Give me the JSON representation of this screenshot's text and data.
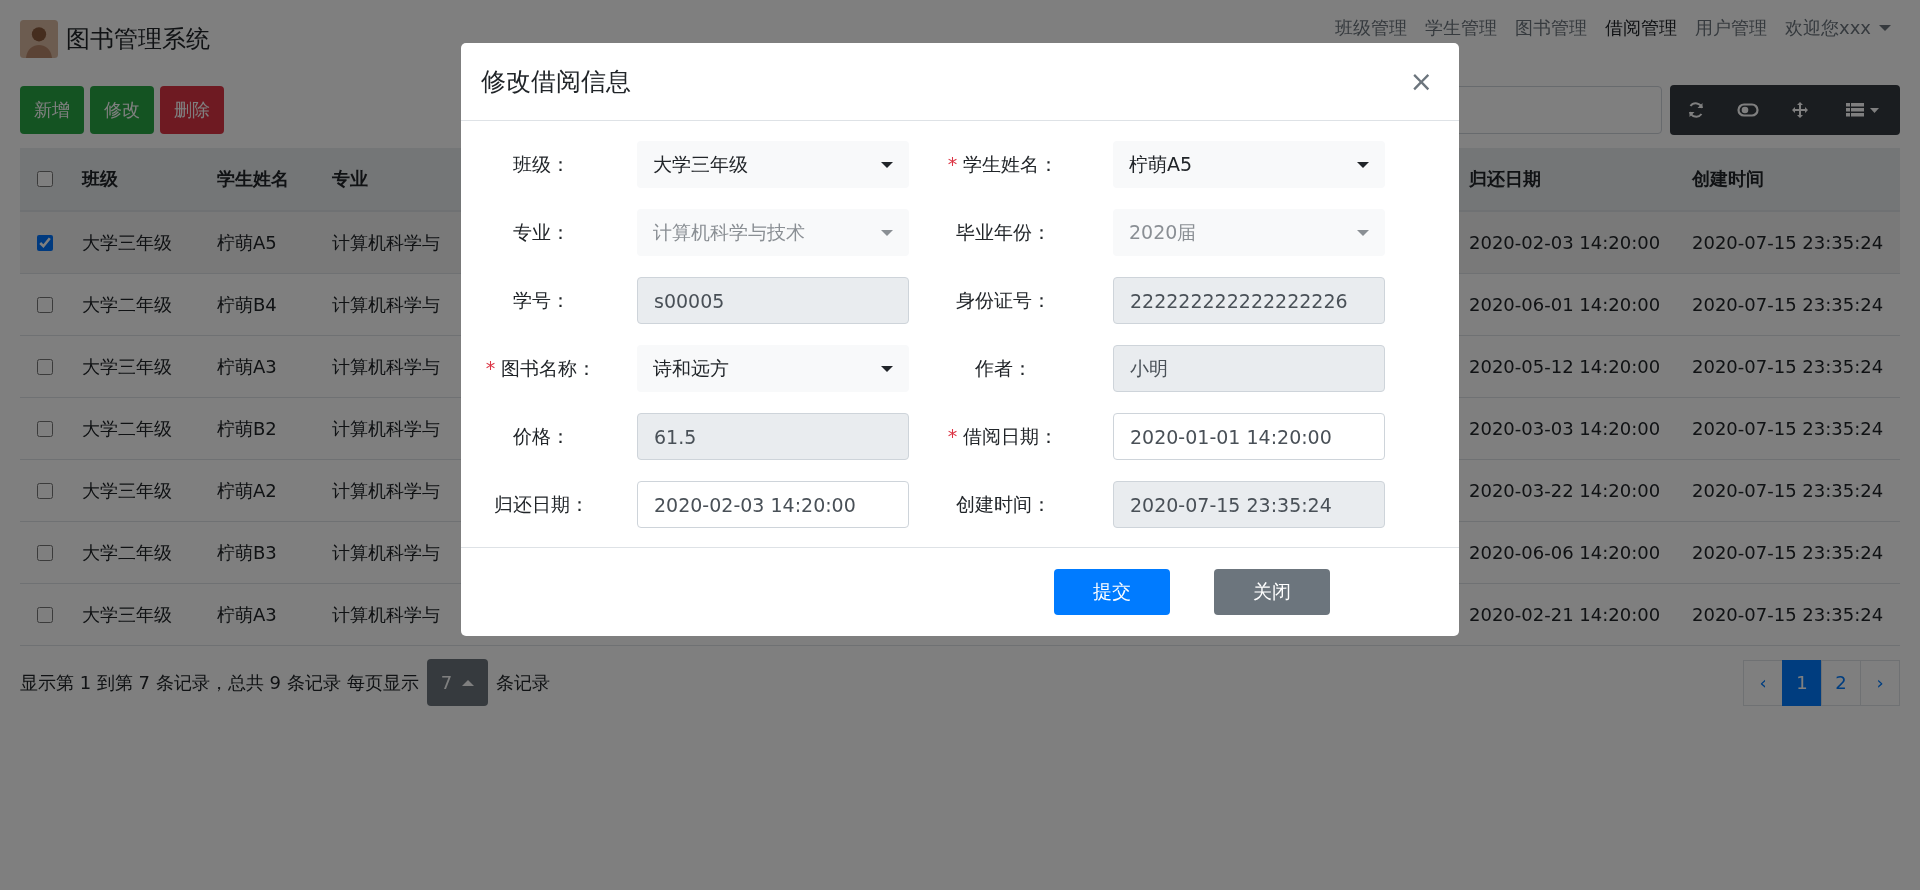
{
  "navbar": {
    "brand": "图书管理系统",
    "items": [
      {
        "label": "班级管理",
        "selected": false
      },
      {
        "label": "学生管理",
        "selected": false
      },
      {
        "label": "图书管理",
        "selected": false
      },
      {
        "label": "借阅管理",
        "selected": true
      },
      {
        "label": "用户管理",
        "selected": false
      }
    ],
    "user_menu": "欢迎您xxx"
  },
  "actions": [
    {
      "label": "新增",
      "kind": "success"
    },
    {
      "label": "修改",
      "kind": "success"
    },
    {
      "label": "删除",
      "kind": "danger"
    }
  ],
  "table": {
    "select_all_checked": false,
    "columns": [
      {
        "label": "班级",
        "kind": "narrow"
      },
      {
        "label": "学生姓名",
        "kind": "narrow"
      },
      {
        "label": "专业",
        "kind": "wide"
      },
      {
        "label": "归还日期",
        "kind": "date"
      },
      {
        "label": "创建时间",
        "kind": "date"
      }
    ],
    "rows": [
      {
        "selected": true,
        "cells": [
          "大学三年级",
          "柠萌A5",
          "计算机科学与",
          "2020-02-03 14:20:00",
          "2020-07-15 23:35:24"
        ]
      },
      {
        "selected": false,
        "cells": [
          "大学二年级",
          "柠萌B4",
          "计算机科学与",
          "2020-06-01 14:20:00",
          "2020-07-15 23:35:24"
        ]
      },
      {
        "selected": false,
        "cells": [
          "大学三年级",
          "柠萌A3",
          "计算机科学与",
          "2020-05-12 14:20:00",
          "2020-07-15 23:35:24"
        ]
      },
      {
        "selected": false,
        "cells": [
          "大学二年级",
          "柠萌B2",
          "计算机科学与",
          "2020-03-03 14:20:00",
          "2020-07-15 23:35:24"
        ]
      },
      {
        "selected": false,
        "cells": [
          "大学三年级",
          "柠萌A2",
          "计算机科学与",
          "2020-03-22 14:20:00",
          "2020-07-15 23:35:24"
        ]
      },
      {
        "selected": false,
        "cells": [
          "大学二年级",
          "柠萌B3",
          "计算机科学与",
          "2020-06-06 14:20:00",
          "2020-07-15 23:35:24"
        ]
      },
      {
        "selected": false,
        "cells": [
          "大学三年级",
          "柠萌A3",
          "计算机科学与",
          "2020-02-21 14:20:00",
          "2020-07-15 23:35:24"
        ]
      }
    ]
  },
  "pagination": {
    "summary": "显示第 1 到第 7 条记录，总共 9 条记录",
    "per_page_label": "每页显示",
    "per_page": "7",
    "per_page_suffix": "条记录",
    "pages": [
      {
        "label": "‹",
        "selected": false
      },
      {
        "label": "1",
        "selected": true
      },
      {
        "label": "2",
        "selected": false
      },
      {
        "label": "›",
        "selected": false
      }
    ]
  },
  "dialog": {
    "title": "修改借阅信息",
    "close": "×",
    "required_mark": "*",
    "fields": [
      {
        "label": "班级：",
        "required": false,
        "kind": "select",
        "value": "大学三年级"
      },
      {
        "label": "学生姓名：",
        "required": true,
        "kind": "select",
        "value": "柠萌A5"
      },
      {
        "label": "专业：",
        "required": false,
        "kind": "select-disabled",
        "value": "计算机科学与技术"
      },
      {
        "label": "毕业年份：",
        "required": false,
        "kind": "select-disabled",
        "value": "2020届"
      },
      {
        "label": "学号：",
        "required": false,
        "kind": "readonly",
        "value": "s00005"
      },
      {
        "label": "身份证号：",
        "required": false,
        "kind": "readonly",
        "value": "222222222222222226"
      },
      {
        "label": "图书名称：",
        "required": true,
        "kind": "select",
        "value": "诗和远方"
      },
      {
        "label": "作者：",
        "required": false,
        "kind": "readonly",
        "value": "小明"
      },
      {
        "label": "价格：",
        "required": false,
        "kind": "readonly",
        "value": "61.5"
      },
      {
        "label": "借阅日期：",
        "required": true,
        "kind": "input",
        "value": "2020-01-01 14:20:00"
      },
      {
        "label": "归还日期：",
        "required": false,
        "kind": "input",
        "value": "2020-02-03 14:20:00"
      },
      {
        "label": "创建时间：",
        "required": false,
        "kind": "readonly",
        "value": "2020-07-15 23:35:24"
      }
    ],
    "buttons": [
      {
        "label": "提交",
        "kind": "primary"
      },
      {
        "label": "关闭",
        "kind": "secondary"
      }
    ]
  }
}
